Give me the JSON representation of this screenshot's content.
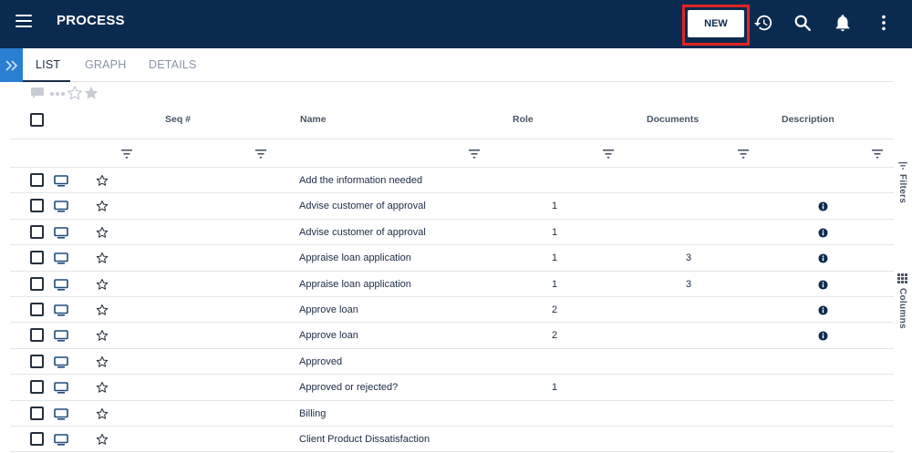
{
  "header": {
    "title": "PROCESS",
    "new_label": "NEW",
    "icons": [
      "menu-icon",
      "history-icon",
      "search-icon",
      "bell-icon",
      "more-vert-icon"
    ]
  },
  "tabs": [
    {
      "label": "LIST",
      "active": true
    },
    {
      "label": "GRAPH",
      "active": false
    },
    {
      "label": "DETAILS",
      "active": false
    }
  ],
  "table": {
    "columns": [
      "Seq #",
      "Name",
      "Role",
      "Documents",
      "Description"
    ],
    "rows": [
      {
        "name": "Add the information needed",
        "role": "",
        "documents": "",
        "has_description": false
      },
      {
        "name": "Advise customer of approval",
        "role": "1",
        "documents": "",
        "has_description": true
      },
      {
        "name": "Advise customer of approval",
        "role": "1",
        "documents": "",
        "has_description": true
      },
      {
        "name": "Appraise loan application",
        "role": "1",
        "documents": "3",
        "has_description": true
      },
      {
        "name": "Appraise loan application",
        "role": "1",
        "documents": "3",
        "has_description": true
      },
      {
        "name": "Approve loan",
        "role": "2",
        "documents": "",
        "has_description": true
      },
      {
        "name": "Approve loan",
        "role": "2",
        "documents": "",
        "has_description": true
      },
      {
        "name": "Approved",
        "role": "",
        "documents": "",
        "has_description": false
      },
      {
        "name": "Approved or rejected?",
        "role": "1",
        "documents": "",
        "has_description": false
      },
      {
        "name": "Billing",
        "role": "",
        "documents": "",
        "has_description": false
      },
      {
        "name": "Client Product Dissatisfaction",
        "role": "",
        "documents": "",
        "has_description": false
      }
    ]
  },
  "side_rail": {
    "filters_label": "Filters",
    "columns_label": "Columns"
  },
  "colors": {
    "topbar": "#0b2a4f",
    "accent": "#2a7fd3",
    "highlight": "#e02424"
  }
}
